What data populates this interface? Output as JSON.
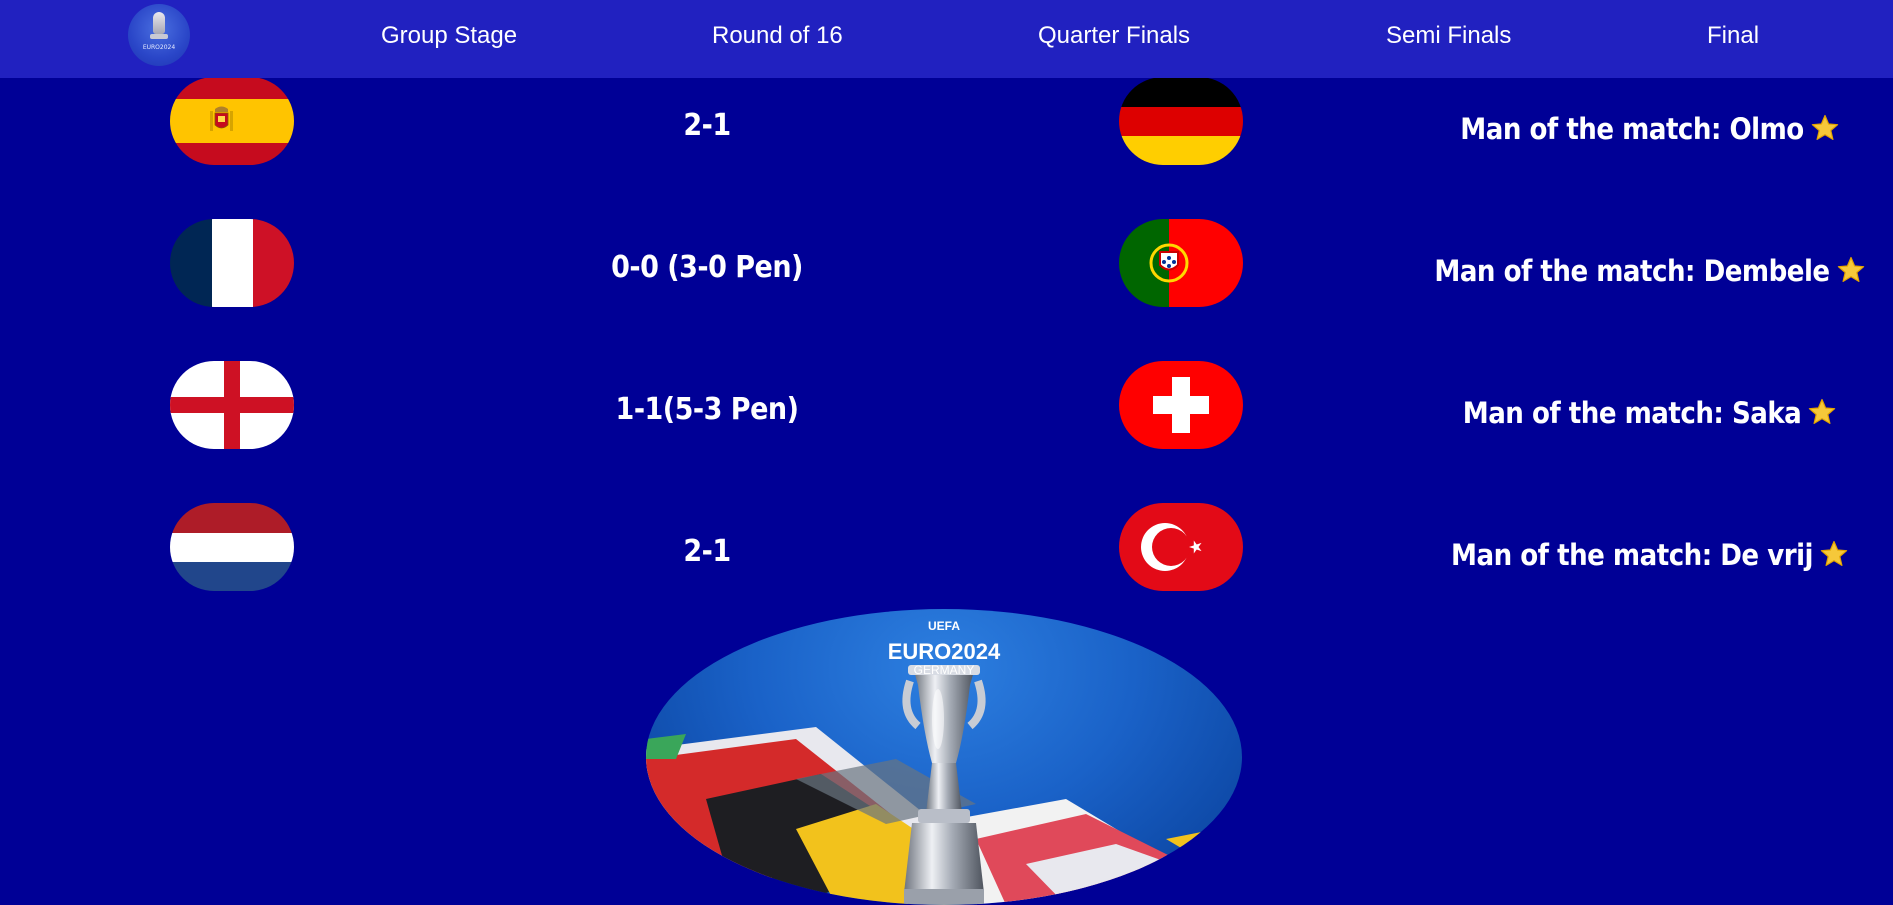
{
  "nav": {
    "logo_text": "EURO2024",
    "items": [
      {
        "label": "Group Stage"
      },
      {
        "label": "Round of 16"
      },
      {
        "label": "Quarter Finals"
      },
      {
        "label": "Semi Finals"
      },
      {
        "label": "Final"
      }
    ]
  },
  "matches": [
    {
      "home": "Spain",
      "away": "Germany",
      "score": "2-1",
      "motm": "Man of the match: Olmo"
    },
    {
      "home": "France",
      "away": "Portugal",
      "score": "0-0 (3-0 Pen)",
      "motm": "Man of the match: Dembele"
    },
    {
      "home": "England",
      "away": "Switzerland",
      "score": "1-1(5-3 Pen)",
      "motm": "Man of the match: Saka"
    },
    {
      "home": "Netherlands",
      "away": "Turkey",
      "score": "2-1",
      "motm": "Man of the match: De vrij"
    }
  ],
  "hero": {
    "uefa": "UEFA",
    "brand": "EURO2024",
    "host": "GERMANY"
  },
  "colors": {
    "background": "#000096",
    "nav": "#2121c0",
    "text": "#ffffff",
    "star": "#f6c83a"
  },
  "icons": {
    "star": "star-icon"
  }
}
